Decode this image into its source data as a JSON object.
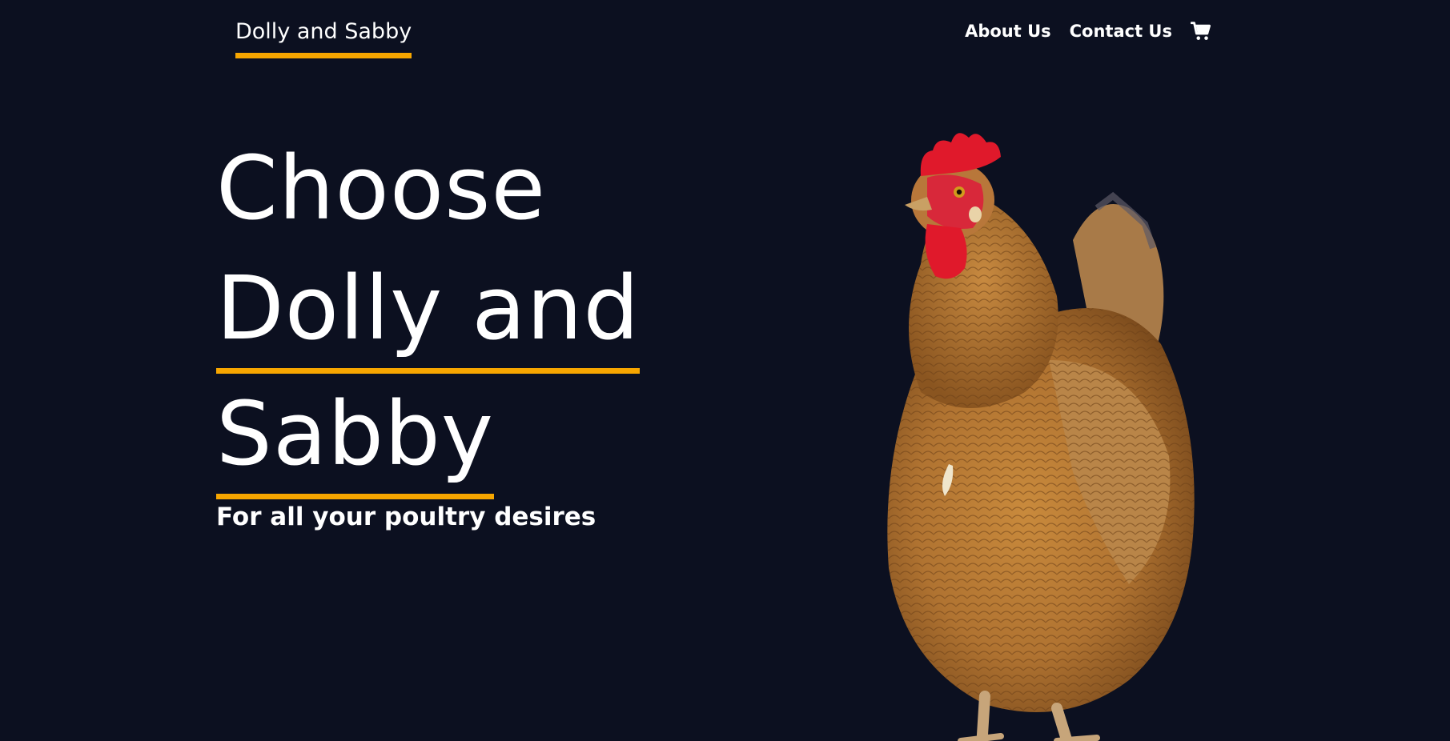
{
  "header": {
    "brand": "Dolly and Sabby",
    "nav": [
      {
        "label": "About Us"
      },
      {
        "label": "Contact Us"
      }
    ],
    "cart_icon": "shopping-cart-icon"
  },
  "hero": {
    "title_lines": [
      "Choose",
      "Dolly and",
      "Sabby"
    ],
    "tagline": "For all your poultry desires"
  },
  "image": {
    "subject": "chicken-image"
  },
  "colors": {
    "background": "#0c1020",
    "accent": "#f7a600",
    "text": "#ffffff"
  }
}
